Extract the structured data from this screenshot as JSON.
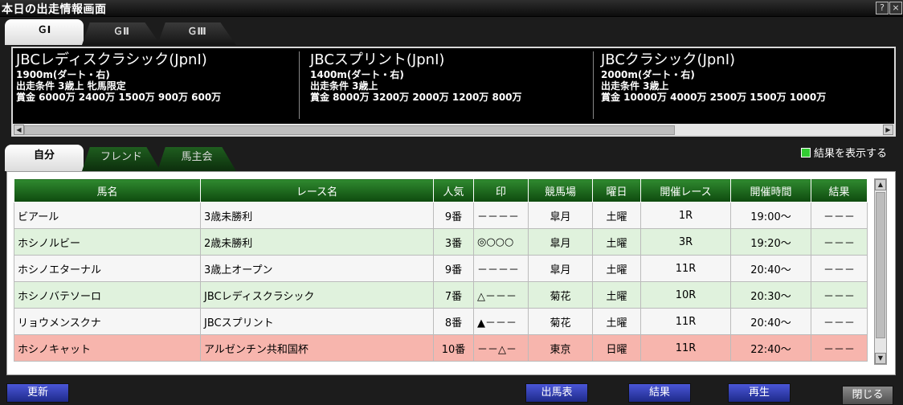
{
  "window": {
    "title": "本日の出走情報画面",
    "help": "?",
    "close": "×"
  },
  "grade_tabs": [
    "ＧⅠ",
    "ＧⅡ",
    "ＧⅢ"
  ],
  "races": [
    {
      "name": "JBCレディスクラシック(JpnⅠ)",
      "distance": "1900m(ダート・右)",
      "conditions": "出走条件 3歳上 牝馬限定",
      "prize": "賞金  6000万 2400万 1500万 900万 600万"
    },
    {
      "name": "JBCスプリント(JpnⅠ)",
      "distance": "1400m(ダート・右)",
      "conditions": "出走条件 3歳上",
      "prize": "賞金  8000万 3200万 2000万 1200万 800万"
    },
    {
      "name": "JBCクラシック(JpnⅠ)",
      "distance": "2000m(ダート・右)",
      "conditions": "出走条件 3歳上",
      "prize": "賞金  10000万 4000万 2500万 1500万 1000万"
    }
  ],
  "user_tabs": [
    "自分",
    "フレンド",
    "馬主会"
  ],
  "show_result_label": "結果を表示する",
  "table": {
    "headers": [
      "馬名",
      "レース名",
      "人気",
      "印",
      "競馬場",
      "曜日",
      "開催レース",
      "開催時間",
      "結果"
    ],
    "rows": [
      [
        "ビアール",
        "3歳未勝利",
        "9番",
        "－－－－",
        "皐月",
        "土曜",
        "1R",
        "19:00～",
        "－－－"
      ],
      [
        "ホシノルビー",
        "2歳未勝利",
        "3番",
        "◎○○○",
        "皐月",
        "土曜",
        "3R",
        "19:20～",
        "－－－"
      ],
      [
        "ホシノエターナル",
        "3歳上オープン",
        "9番",
        "－－－－",
        "皐月",
        "土曜",
        "11R",
        "20:40～",
        "－－－"
      ],
      [
        "ホシノバテソーロ",
        "JBCレディスクラシック",
        "7番",
        "△－－－",
        "菊花",
        "土曜",
        "10R",
        "20:30～",
        "－－－"
      ],
      [
        "リョウメンスクナ",
        "JBCスプリント",
        "8番",
        "▲－－－",
        "菊花",
        "土曜",
        "11R",
        "20:40～",
        "－－－"
      ],
      [
        "ホシノキャット",
        "アルゼンチン共和国杯",
        "10番",
        "－－△－",
        "東京",
        "日曜",
        "11R",
        "22:40～",
        "－－－"
      ]
    ]
  },
  "buttons": {
    "refresh": "更新",
    "entries": "出馬表",
    "results": "結果",
    "replay": "再生",
    "close": "閉じる"
  },
  "colors": {
    "header_green": "#1f6e1f",
    "selected_row": "#f7b5ad",
    "button_blue": "#3340b8"
  }
}
